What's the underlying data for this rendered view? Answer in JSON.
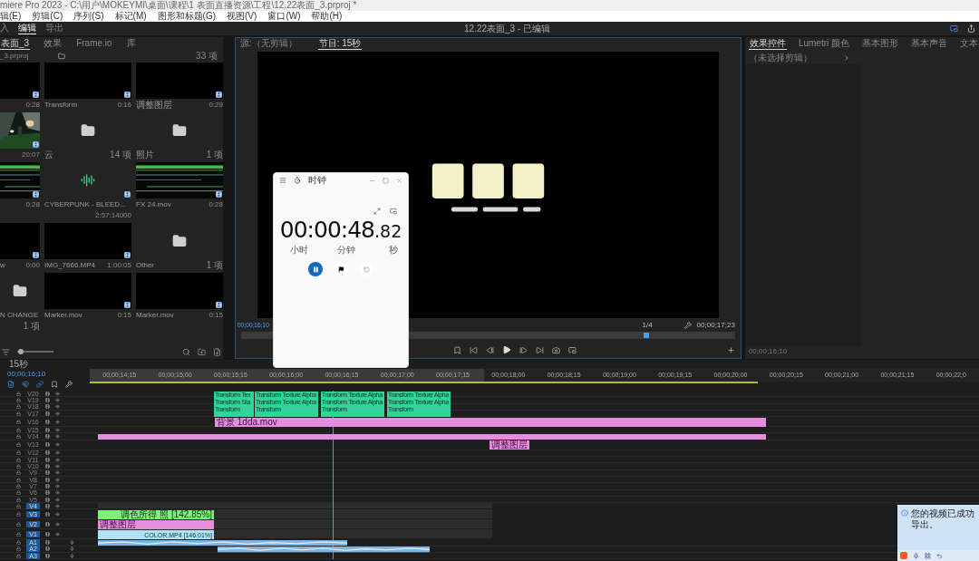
{
  "title_bar": "miere Pro 2023 - C:\\用户\\MOKEYMI\\桌面\\课程\\1 表面直播资源\\工程\\12.22表面_3.prproj *",
  "menu": [
    "辑(E)",
    "剪辑(C)",
    "序列(S)",
    "标记(M)",
    "图形和标题(G)",
    "视图(V)",
    "窗口(W)",
    "帮助(H)"
  ],
  "workspaces": [
    {
      "label": "入",
      "selected": false
    },
    {
      "label": "编辑",
      "selected": true
    },
    {
      "label": "导出",
      "selected": false
    }
  ],
  "document_title": "12.22表面_3 - 已编辑",
  "project_panel": {
    "tabs": [
      {
        "label": "表面_3",
        "selected": true
      },
      {
        "label": "效果",
        "selected": false
      },
      {
        "label": "Frame.io",
        "selected": false
      },
      {
        "label": "库",
        "selected": false
      }
    ],
    "path": "_3.prproj",
    "item_count": "33 项",
    "zoom_slider": {
      "level": 0.1
    },
    "items": [
      {
        "kind": "clip",
        "duration": "0:28"
      },
      {
        "kind": "clip",
        "name": "Transform",
        "duration": "0:16"
      },
      {
        "kind": "clip",
        "name": "调整图层",
        "duration": "0:29"
      },
      {
        "duration": "20:07"
      },
      {
        "kind": "folder",
        "name": "云",
        "duration": "14 项"
      },
      {
        "kind": "folder",
        "name": "照片",
        "duration": "1 项"
      },
      {
        "kind": "waveform",
        "duration": "0:28"
      },
      {
        "kind": "audio",
        "name": "CYBERPUNK - BLEED...",
        "duration": "2:57:14000"
      },
      {
        "kind": "waveform",
        "name": "FX 24.mov",
        "duration": "0:28"
      },
      {
        "kind": "clip",
        "name": "w",
        "duration": "0:00"
      },
      {
        "kind": "clip",
        "name": "IMG_7666.MP4",
        "duration": "1:00:05"
      },
      {
        "kind": "folder",
        "name": "Other",
        "duration": "1 项"
      },
      {
        "kind": "folder",
        "name": "N CHANGE",
        "duration": "1 项"
      },
      {
        "kind": "clip",
        "name": "Marker.mov",
        "duration": "0:15"
      },
      {
        "kind": "clip",
        "name": "Marker.mov",
        "duration": "0:15"
      }
    ]
  },
  "program_monitor": {
    "tabs": [
      {
        "label": "源:（无剪辑）",
        "selected": false
      },
      {
        "label": "节目: 15秒",
        "selected": true
      }
    ],
    "timecode": "00;00;16;10",
    "zoom": "1/4",
    "duration": "00;00;17;23",
    "playhead": {
      "level": 0.82
    }
  },
  "effect_controls": {
    "tabs": [
      {
        "label": "效果控件",
        "selected": true
      },
      {
        "label": "Lumetri 颜色",
        "selected": false
      },
      {
        "label": "基本图形",
        "selected": false
      },
      {
        "label": "基本声音",
        "selected": false
      },
      {
        "label": "文本",
        "selected": false
      }
    ],
    "clip_selector": "（未选择剪辑）",
    "timecode": "00;00;16;10"
  },
  "stopwatch": {
    "title": "时钟",
    "time_main": "00:00:48",
    "time_fraction": ".82",
    "units": [
      "小时",
      "分钟",
      "秒"
    ],
    "running": true
  },
  "timeline": {
    "tab": "15秒",
    "timecode": "00;00;16;10",
    "ruler": [
      "00;00;14;15",
      "00;00;15;00",
      "00;00;15;15",
      "00;00;16;00",
      "00;00;16;15",
      "00;00;17;00",
      "00;00;17;15",
      "00;00;18;00",
      "00;00;18;15",
      "00;00;19;00",
      "00;00;19;15",
      "00;00;20;00",
      "00;00;20;15",
      "00;00;21;00",
      "00;00;21;15",
      "00;00;22;0"
    ],
    "tracks": [
      {
        "label": "V20",
        "targeted": false
      },
      {
        "label": "V19",
        "targeted": false
      },
      {
        "label": "V18",
        "targeted": false
      },
      {
        "label": "V17",
        "targeted": false
      },
      {
        "label": "V16",
        "targeted": false
      },
      {
        "label": "V15",
        "targeted": false
      },
      {
        "label": "V14",
        "targeted": false
      },
      {
        "label": "V13",
        "targeted": false
      },
      {
        "label": "V12",
        "targeted": false
      },
      {
        "label": "V11",
        "targeted": false
      },
      {
        "label": "V10",
        "targeted": false
      },
      {
        "label": "V9",
        "targeted": false
      },
      {
        "label": "V8",
        "targeted": false
      },
      {
        "label": "V7",
        "targeted": false
      },
      {
        "label": "V6",
        "targeted": false
      },
      {
        "label": "V5",
        "targeted": false
      },
      {
        "label": "V4",
        "targeted": true
      },
      {
        "label": "V3",
        "targeted": true
      },
      {
        "label": "V2",
        "targeted": true
      },
      {
        "label": "V1",
        "targeted": true
      },
      {
        "label": "A1",
        "targeted": true,
        "kind": "audio"
      },
      {
        "label": "A2",
        "targeted": true,
        "kind": "audio"
      },
      {
        "label": "A3",
        "targeted": true,
        "kind": "audio"
      }
    ],
    "clips": [
      {
        "kind": "effect",
        "lines": [
          "Transform Tex",
          "Transform Sta",
          "Transform"
        ]
      },
      {
        "kind": "effect",
        "lines": [
          "Transform Texture Alpha",
          "Transform Texture Alpha",
          "Transform"
        ]
      },
      {
        "kind": "effect",
        "lines": [
          "Transform Texture Alpha",
          "Transform Texture Alpha",
          "Transform"
        ]
      },
      {
        "kind": "effect",
        "lines": [
          "Transform Texture Alpha",
          "Transform Texture Alpha",
          "Transform"
        ]
      },
      {
        "kind": "pink",
        "label": "背景 1dda.mov"
      },
      {
        "kind": "pink"
      },
      {
        "kind": "pink",
        "label": "调整图层"
      },
      {
        "kind": "green",
        "label": "调色所得 照 [142.85%]"
      },
      {
        "kind": "pink",
        "label": "调整图层"
      },
      {
        "kind": "blue",
        "label": "COLOR.MP4 [146.01%]"
      },
      {
        "kind": "audio"
      },
      {
        "kind": "audio"
      }
    ]
  },
  "notification": {
    "message": "您的视频已成功导出。"
  }
}
